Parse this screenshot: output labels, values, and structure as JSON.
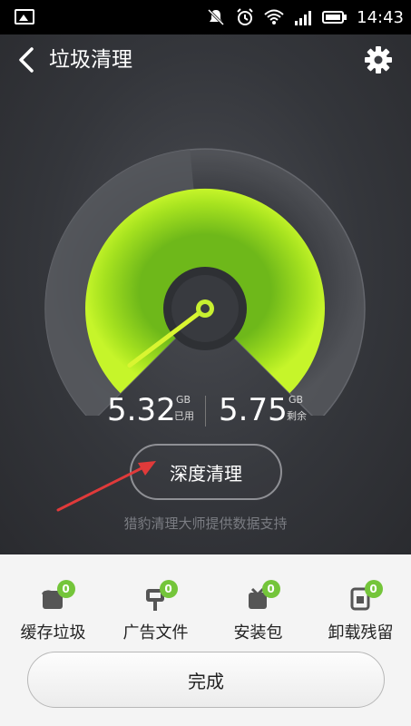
{
  "status_bar": {
    "time": "14:43",
    "icons": [
      "image-icon",
      "mute-icon",
      "alarm-icon",
      "wifi-icon",
      "signal-icon",
      "battery-icon"
    ]
  },
  "header": {
    "title": "垃圾清理",
    "back_icon": "chevron-left-icon",
    "settings_icon": "gear-icon"
  },
  "storage": {
    "used_value": "5.32",
    "used_unit": "GB",
    "used_label": "已用",
    "free_value": "5.75",
    "free_unit": "GB",
    "free_label": "剩余",
    "used_fraction": 0.48
  },
  "actions": {
    "deep_clean_label": "深度清理",
    "credit": "猎豹清理大师提供数据支持",
    "done_label": "完成"
  },
  "categories": [
    {
      "label": "缓存垃圾",
      "count": "0",
      "icon": "cache-trash-icon"
    },
    {
      "label": "广告文件",
      "count": "0",
      "icon": "ad-file-icon"
    },
    {
      "label": "安装包",
      "count": "0",
      "icon": "install-package-icon"
    },
    {
      "label": "卸载残留",
      "count": "0",
      "icon": "uninstall-residue-icon"
    }
  ],
  "colors": {
    "accent_green": "#b8f018",
    "badge_green": "#74c53a",
    "app_bg": "#34363b"
  }
}
